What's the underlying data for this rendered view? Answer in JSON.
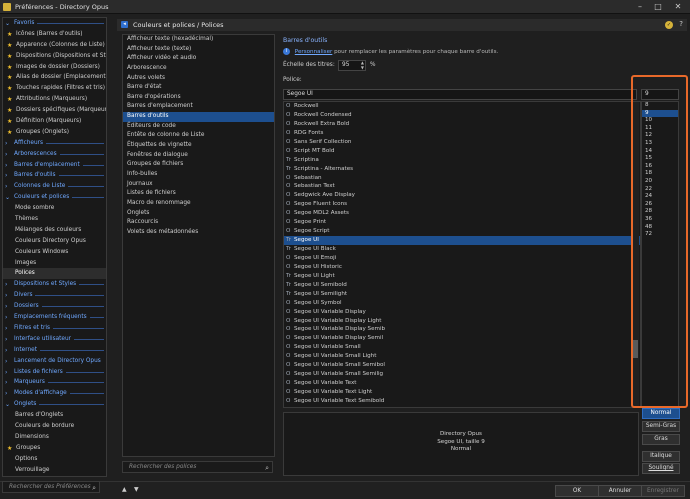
{
  "window": {
    "title": "Préférences - Directory Opus"
  },
  "sidebar": {
    "items": [
      {
        "label": "Favoris",
        "type": "cat",
        "marker": "⌄",
        "indent": 2
      },
      {
        "label": "Icônes (Barres d'outils)",
        "type": "fav",
        "marker": "★",
        "indent": 4
      },
      {
        "label": "Apparence (Colonnes de Liste)",
        "type": "fav",
        "marker": "★",
        "indent": 4
      },
      {
        "label": "Dispositions (Dispositions et Styl...",
        "type": "fav",
        "marker": "★",
        "indent": 4
      },
      {
        "label": "Images de dossier (Dossiers)",
        "type": "fav",
        "marker": "★",
        "indent": 4
      },
      {
        "label": "Alias de dossier (Emplacements f...",
        "type": "fav",
        "marker": "★",
        "indent": 4
      },
      {
        "label": "Touches rapides (Filtres et tris)",
        "type": "fav",
        "marker": "★",
        "indent": 4
      },
      {
        "label": "Attributions (Marqueurs)",
        "type": "fav",
        "marker": "★",
        "indent": 4
      },
      {
        "label": "Dossiers spécifiques (Marqueurs...",
        "type": "fav",
        "marker": "★",
        "indent": 4
      },
      {
        "label": "Définition (Marqueurs)",
        "type": "fav",
        "marker": "★",
        "indent": 4
      },
      {
        "label": "Groupes (Onglets)",
        "type": "fav",
        "marker": "★",
        "indent": 4
      },
      {
        "label": "Afficheurs",
        "type": "cat",
        "marker": "›",
        "indent": 2
      },
      {
        "label": "Arborescences",
        "type": "cat",
        "marker": "›",
        "indent": 2
      },
      {
        "label": "Barres d'emplacement",
        "type": "cat",
        "marker": "›",
        "indent": 2
      },
      {
        "label": "Barres d'outils",
        "type": "cat",
        "marker": "›",
        "indent": 2
      },
      {
        "label": "Colonnes de Liste",
        "type": "cat",
        "marker": "›",
        "indent": 2
      },
      {
        "label": "Couleurs et polices",
        "type": "cat",
        "marker": "⌄",
        "indent": 2
      },
      {
        "label": "Mode sombre",
        "type": "item",
        "marker": "",
        "indent": 12
      },
      {
        "label": "Thèmes",
        "type": "item",
        "marker": "",
        "indent": 12
      },
      {
        "label": "Mélanges des couleurs",
        "type": "item",
        "marker": "",
        "indent": 12
      },
      {
        "label": "Couleurs Directory Opus",
        "type": "item",
        "marker": "",
        "indent": 12
      },
      {
        "label": "Couleurs Windows",
        "type": "item",
        "marker": "",
        "indent": 12
      },
      {
        "label": "Images",
        "type": "item",
        "marker": "",
        "indent": 12
      },
      {
        "label": "Polices",
        "type": "item",
        "marker": "",
        "indent": 12,
        "selected": true
      },
      {
        "label": "Dispositions et Styles",
        "type": "cat",
        "marker": "›",
        "indent": 2
      },
      {
        "label": "Divers",
        "type": "cat",
        "marker": "›",
        "indent": 2
      },
      {
        "label": "Dossiers",
        "type": "cat",
        "marker": "›",
        "indent": 2
      },
      {
        "label": "Emplacements fréquents",
        "type": "cat",
        "marker": "›",
        "indent": 2
      },
      {
        "label": "Filtres et tris",
        "type": "cat",
        "marker": "›",
        "indent": 2
      },
      {
        "label": "Interface utilisateur",
        "type": "cat",
        "marker": "›",
        "indent": 2
      },
      {
        "label": "Internet",
        "type": "cat",
        "marker": "›",
        "indent": 2
      },
      {
        "label": "Lancement de Directory Opus",
        "type": "cat",
        "marker": "›",
        "indent": 2
      },
      {
        "label": "Listes de fichiers",
        "type": "cat",
        "marker": "›",
        "indent": 2
      },
      {
        "label": "Marqueurs",
        "type": "cat",
        "marker": "›",
        "indent": 2
      },
      {
        "label": "Modes d'affichage",
        "type": "cat",
        "marker": "›",
        "indent": 2
      },
      {
        "label": "Onglets",
        "type": "cat",
        "marker": "⌄",
        "indent": 2
      },
      {
        "label": "Barres d'Onglets",
        "type": "item",
        "marker": "",
        "indent": 12
      },
      {
        "label": "Couleurs de bordure",
        "type": "item",
        "marker": "",
        "indent": 12
      },
      {
        "label": "Dimensions",
        "type": "item",
        "marker": "",
        "indent": 12
      },
      {
        "label": "Groupes",
        "type": "fav",
        "marker": "★",
        "indent": 4
      },
      {
        "label": "Options",
        "type": "item",
        "marker": "",
        "indent": 12
      },
      {
        "label": "Verrouillage",
        "type": "item",
        "marker": "",
        "indent": 12
      }
    ],
    "search_placeholder": "Rechercher des Préférences"
  },
  "header": {
    "title": "Couleurs et polices / Polices"
  },
  "middle": {
    "items": [
      "Afficheur texte (hexadécimal)",
      "Afficheur texte (texte)",
      "Afficheur vidéo et audio",
      "Arborescence",
      "Autres volets",
      "Barre d'état",
      "Barre d'opérations",
      "Barres d'emplacement",
      "Barres d'outils",
      "Éditeurs de code",
      "Entête de colonne de Liste",
      "Étiquettes de vignette",
      "Fenêtres de dialogue",
      "Groupes de fichiers",
      "Info-bulles",
      "Journaux",
      "Listes de fichiers",
      "Macro de renommage",
      "Onglets",
      "Raccourcis",
      "Volets des métadonnées"
    ],
    "selected_index": 8,
    "search_placeholder": "Rechercher des polices"
  },
  "settings": {
    "section_title": "Barres d'outils",
    "info_link": "Personnaliser",
    "info_text": "pour remplacer les paramètres pour chaque barre d'outils.",
    "scale_label": "Échelle des titres:",
    "scale_value": "95",
    "scale_unit": "%",
    "font_label": "Police:",
    "font_value": "Segoe UI",
    "size_value": "9"
  },
  "fonts": {
    "items": [
      {
        "name": "Rockwell",
        "icon": "O"
      },
      {
        "name": "Rockwell Condensed",
        "icon": "O"
      },
      {
        "name": "Rockwell Extra Bold",
        "icon": "O"
      },
      {
        "name": "RDG Fonts",
        "icon": "O"
      },
      {
        "name": "Sans Serif Collection",
        "icon": "O"
      },
      {
        "name": "Script MT Bold",
        "icon": "O"
      },
      {
        "name": "Scriptina",
        "icon": "Tr"
      },
      {
        "name": "Scriptina - Alternates",
        "icon": "Tr"
      },
      {
        "name": "Sebastian",
        "icon": "O"
      },
      {
        "name": "Sebastian Text",
        "icon": "O"
      },
      {
        "name": "Sedgwick Ave Display",
        "icon": "O"
      },
      {
        "name": "Segoe Fluent Icons",
        "icon": "O"
      },
      {
        "name": "Segoe MDL2 Assets",
        "icon": "O"
      },
      {
        "name": "Segoe Print",
        "icon": "O"
      },
      {
        "name": "Segoe Script",
        "icon": "O"
      },
      {
        "name": "Segoe UI",
        "icon": "Tr",
        "selected": true
      },
      {
        "name": "Segoe UI Black",
        "icon": "Tr"
      },
      {
        "name": "Segoe UI Emoji",
        "icon": "O"
      },
      {
        "name": "Segoe UI Historic",
        "icon": "O"
      },
      {
        "name": "Segoe UI Light",
        "icon": "Tr"
      },
      {
        "name": "Segoe UI Semibold",
        "icon": "Tr"
      },
      {
        "name": "Segoe UI Semilight",
        "icon": "Tr"
      },
      {
        "name": "Segoe UI Symbol",
        "icon": "O"
      },
      {
        "name": "Segoe UI Variable Display",
        "icon": "O"
      },
      {
        "name": "Segoe UI Variable Display Light",
        "icon": "O"
      },
      {
        "name": "Segoe UI Variable Display Semib",
        "icon": "O"
      },
      {
        "name": "Segoe UI Variable Display Semil",
        "icon": "O"
      },
      {
        "name": "Segoe UI Variable Small",
        "icon": "O"
      },
      {
        "name": "Segoe UI Variable Small Light",
        "icon": "O"
      },
      {
        "name": "Segoe UI Variable Small Semibol",
        "icon": "O"
      },
      {
        "name": "Segoe UI Variable Small Semilig",
        "icon": "O"
      },
      {
        "name": "Segoe UI Variable Text",
        "icon": "O"
      },
      {
        "name": "Segoe UI Variable Text Light",
        "icon": "O"
      },
      {
        "name": "Segoe UI Variable Text Semibold",
        "icon": "O"
      }
    ]
  },
  "sizes": {
    "items": [
      "8",
      "9",
      "10",
      "11",
      "12",
      "13",
      "14",
      "15",
      "16",
      "18",
      "20",
      "22",
      "24",
      "26",
      "28",
      "36",
      "48",
      "72"
    ],
    "selected_index": 1
  },
  "preview": {
    "line1": "Directory Opus",
    "line2": "Segoe UI, taille 9",
    "line3": "Normal"
  },
  "weight_buttons": {
    "normal": "Normal",
    "semibold": "Semi-Gras",
    "bold": "Gras",
    "italic": "Italique",
    "underline": "Souligné"
  },
  "bottom": {
    "ok": "OK",
    "cancel": "Annuler",
    "apply": "Enregistrer"
  }
}
